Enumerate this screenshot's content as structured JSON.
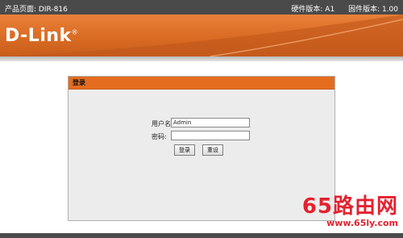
{
  "topbar": {
    "product_page": "产品页面: DIR-816",
    "hardware_version": "硬件版本: A1",
    "firmware_version": "固件版本: 1.00"
  },
  "header": {
    "brand": "D-Link"
  },
  "login_panel": {
    "title": "登录",
    "username_label": "用户名:",
    "username_value": "Admin",
    "password_label": "密码:",
    "password_value": "",
    "login_button": "登录",
    "reset_button": "重设"
  },
  "watermark": {
    "line1": "65路由网",
    "line2": "www.65ly.com"
  },
  "colors": {
    "accent": "#e46c1f",
    "header": "#d86a22",
    "topbar": "#4a4a4a"
  }
}
